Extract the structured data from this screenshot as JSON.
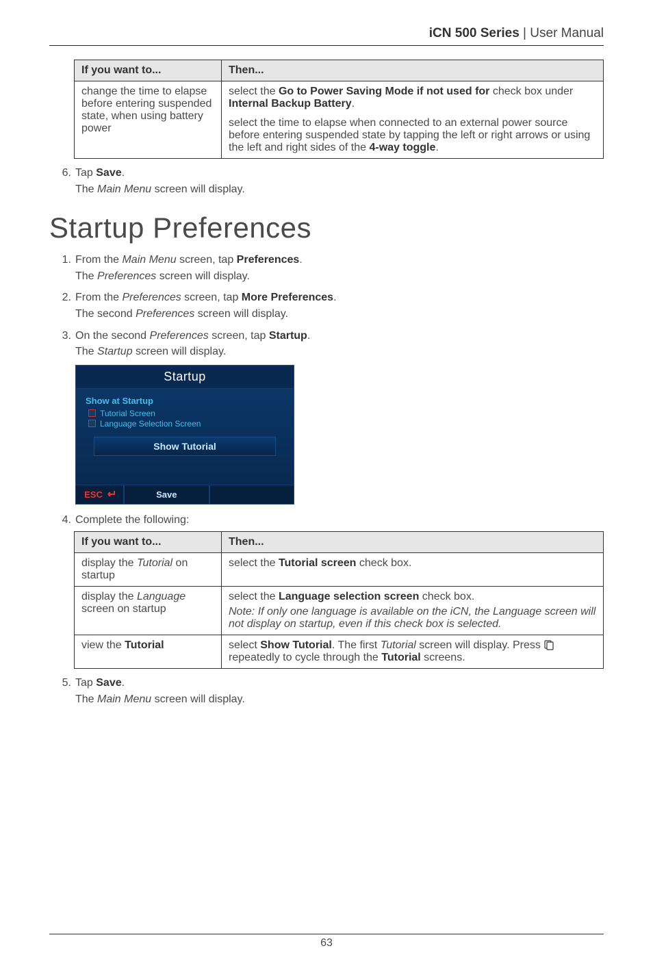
{
  "running_head": {
    "product": "iCN 500 Series",
    "separator": " | ",
    "doc": "User Manual"
  },
  "page_number": "63",
  "table1": {
    "header": {
      "col1": "If you want to...",
      "col2": "Then..."
    },
    "row": {
      "want": "change the time to elapse before entering suspended state, when using battery power",
      "then": {
        "p1_pre": "select the ",
        "p1_bold": "Go to Power Saving Mode if not used for",
        "p1_mid": " check box under ",
        "p1_bold2": "Internal Backup Battery",
        "p1_post": ".",
        "p2_pre": "select the time to elapse when connected to an external power source before entering suspended state by tapping the left or right arrows or using the left and right sides of the ",
        "p2_bold": "4-way toggle",
        "p2_post": "."
      }
    }
  },
  "step6": {
    "num": "6.",
    "line1_pre": "Tap ",
    "line1_bold": "Save",
    "line1_post": ".",
    "line2_pre": "The ",
    "line2_it": "Main Menu",
    "line2_post": " screen will display."
  },
  "section_title": "Startup Preferences",
  "steps": [
    {
      "num": "1.",
      "l1_pre": "From the ",
      "l1_it": "Main Menu",
      "l1_mid": " screen, tap ",
      "l1_bold": "Preferences",
      "l1_post": ".",
      "l2_pre": "The ",
      "l2_it": "Preferences",
      "l2_post": " screen will display."
    },
    {
      "num": "2.",
      "l1_pre": "From the ",
      "l1_it": "Preferences",
      "l1_mid": " screen, tap ",
      "l1_bold": "More Preferences",
      "l1_post": ".",
      "l2_pre": "The second ",
      "l2_it": "Preferences",
      "l2_post": " screen will display."
    },
    {
      "num": "3.",
      "l1_pre": "On the second ",
      "l1_it": "Preferences",
      "l1_mid": " screen, tap ",
      "l1_bold": "Startup",
      "l1_post": ".",
      "l2_pre": "The ",
      "l2_it": "Startup",
      "l2_post": " screen will display."
    }
  ],
  "device": {
    "title": "Startup",
    "heading": "Show at Startup",
    "opt1": "Tutorial Screen",
    "opt2": "Language Selection Screen",
    "btn": "Show Tutorial",
    "esc": "ESC",
    "save": "Save"
  },
  "step4_intro": {
    "num": "4.",
    "text": "Complete the following:"
  },
  "table2": {
    "header": {
      "col1": "If you want to...",
      "col2": "Then..."
    },
    "rows": [
      {
        "want_pre": "display the ",
        "want_it": "Tutorial",
        "want_post": " on startup",
        "then_pre": "select the ",
        "then_bold": "Tutorial screen",
        "then_post": " check box."
      },
      {
        "want_pre": "display the ",
        "want_it": "Language",
        "want_post": " screen on startup",
        "then_pre": "select the ",
        "then_bold": "Language selection screen",
        "then_post": " check box.",
        "note_pre": "Note: If only one language is available on the iCN, the Language ",
        "note_post": "screen will not display on startup, even if this check box is selected."
      },
      {
        "want_pre": "view the ",
        "want_bold": "Tutorial",
        "want_post": "",
        "then_pre": "select ",
        "then_bold": "Show Tutorial",
        "then_mid": ". The first ",
        "then_it": "Tutorial",
        "then_mid2": " screen will display. Press ",
        "then_post": " repeatedly to cycle through the ",
        "then_bold2": "Tutorial",
        "then_end": " screens."
      }
    ]
  },
  "step5": {
    "num": "5.",
    "line1_pre": "Tap ",
    "line1_bold": "Save",
    "line1_post": ".",
    "line2_pre": "The ",
    "line2_it": "Main Menu",
    "line2_post": " screen will display."
  }
}
